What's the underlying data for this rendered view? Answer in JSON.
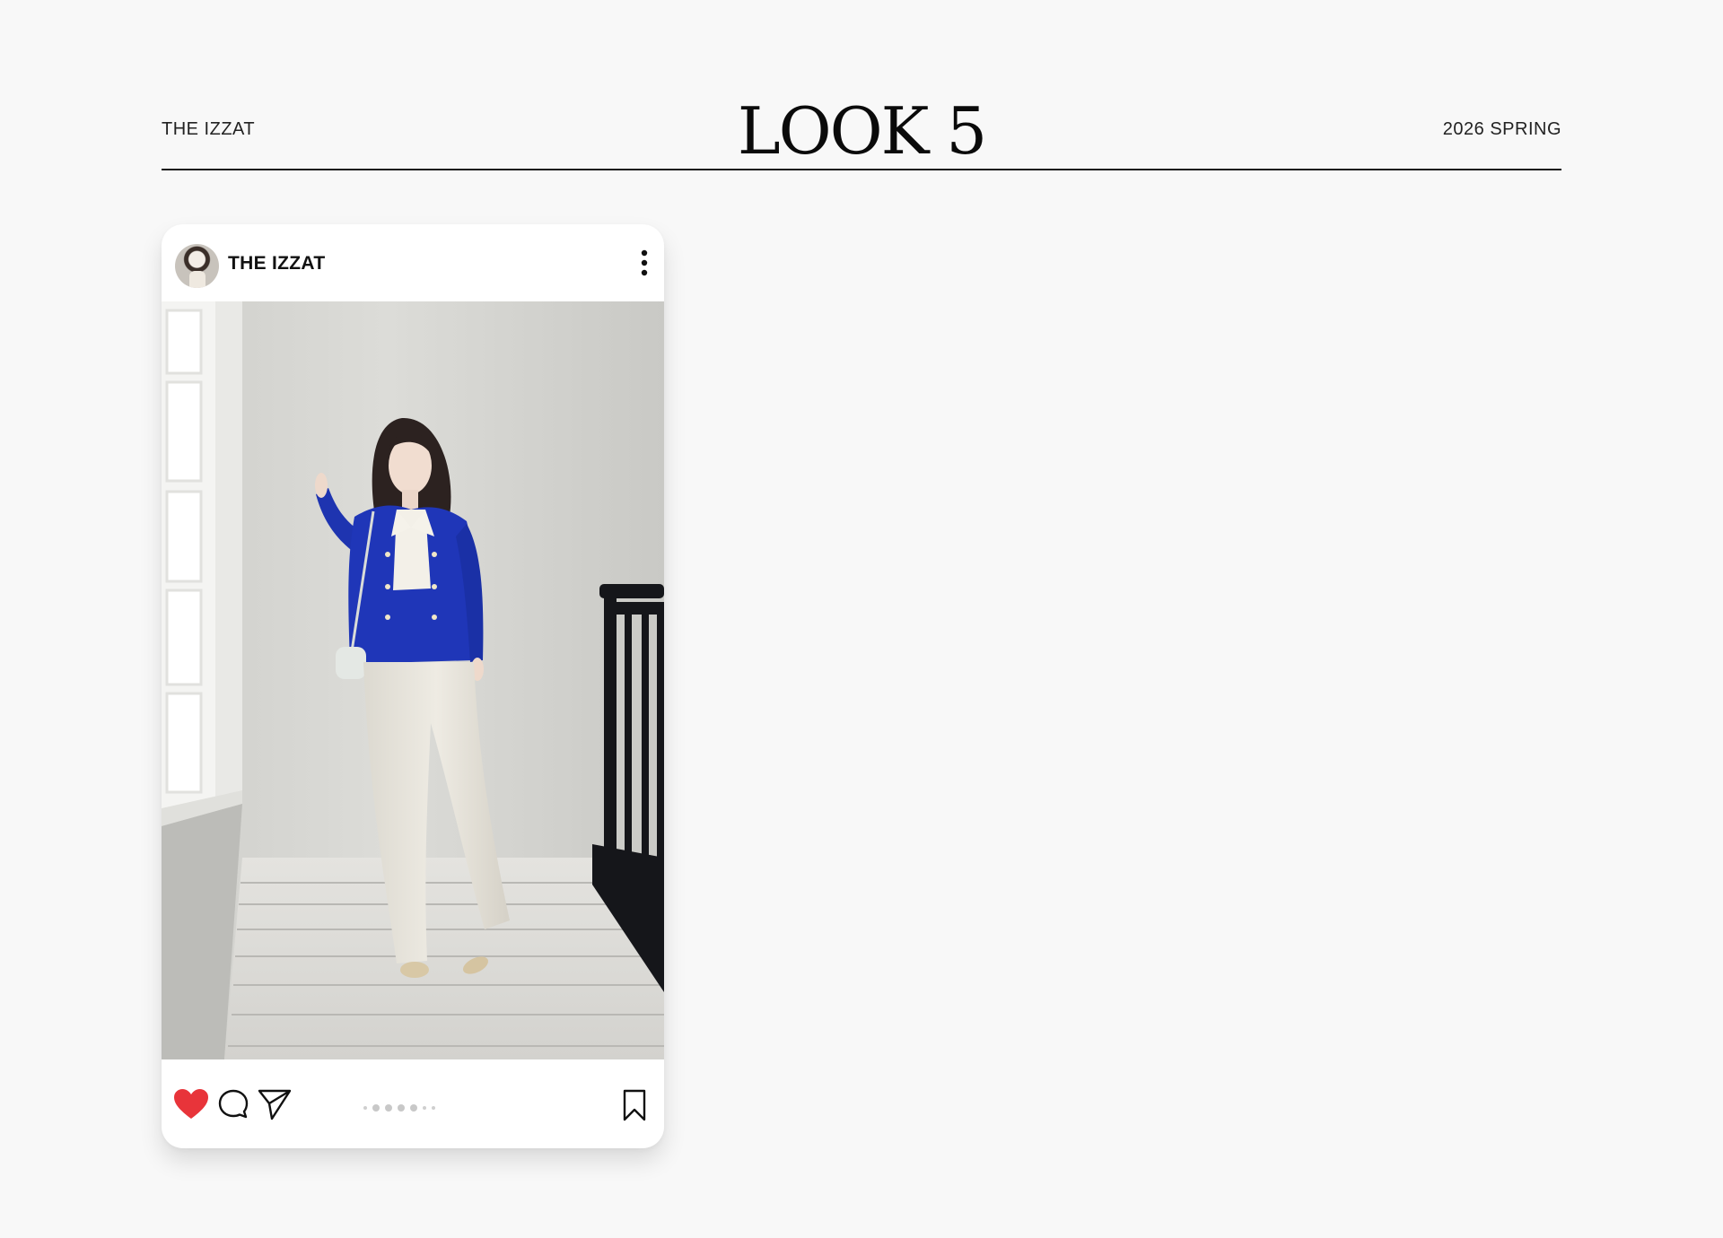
{
  "header": {
    "brand_left": "THE IZZAT",
    "title": "LOOK 5",
    "season": "2026 SPRING"
  },
  "post": {
    "username": "THE IZZAT",
    "carousel_dots": 7,
    "icons": {
      "avatar": "avatar",
      "more": "more-vertical-icon",
      "like": "heart-icon",
      "comment": "comment-icon",
      "share": "send-icon",
      "save": "bookmark-icon"
    },
    "like_color": "#e8343a"
  }
}
